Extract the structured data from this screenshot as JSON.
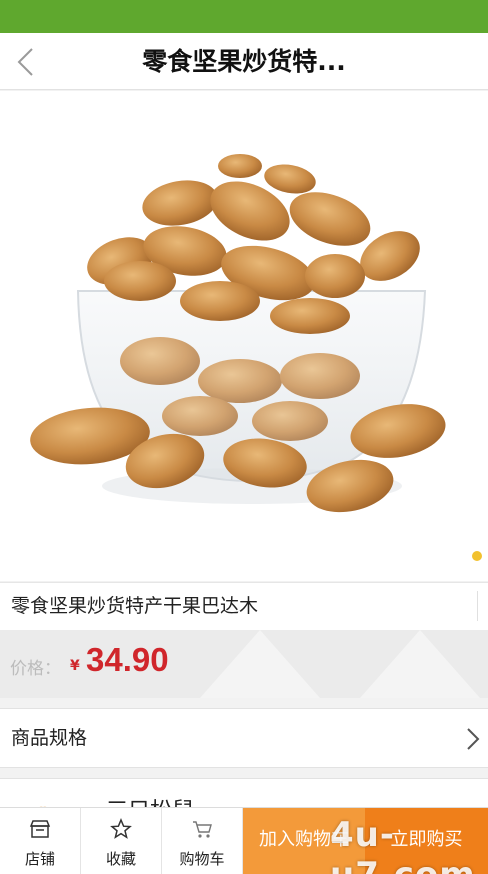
{
  "nav": {
    "title": "零食坚果炒货特..."
  },
  "gallery": {
    "image_alt": "almond-bowl-product-photo",
    "active_dot_color": "#f2c12e"
  },
  "product": {
    "title": "零食坚果炒货特产干果巴达木"
  },
  "price": {
    "label": "价格：",
    "currency": "¥",
    "value": "34.90",
    "color": "#d0262b"
  },
  "spec": {
    "label": "商品规格"
  },
  "shop": {
    "name": "三只松鼠"
  },
  "bottom_bar": {
    "tabs": [
      {
        "label": "店铺",
        "icon": "store-icon"
      },
      {
        "label": "收藏",
        "icon": "star-icon"
      },
      {
        "label": "购物车",
        "icon": "cart-icon"
      }
    ],
    "add_to_cart": "加入购物车",
    "buy_now": "立即购买"
  },
  "watermark": "4u-u7.com",
  "colors": {
    "status_bar": "#5fa82e",
    "cart_button": "#f39a3a",
    "buy_button": "#ef7f1a"
  }
}
